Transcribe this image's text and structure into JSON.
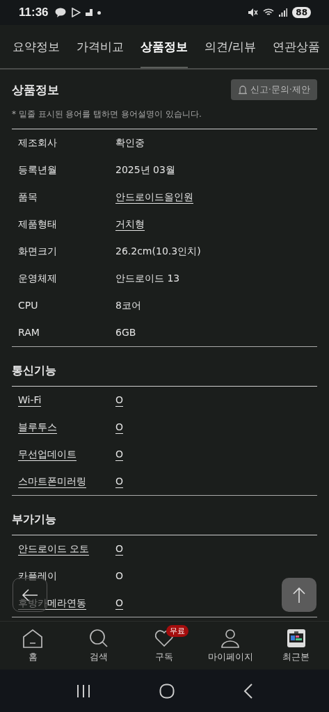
{
  "status_bar": {
    "time": "11:36",
    "battery": "88"
  },
  "tabs": [
    {
      "label": "요약정보",
      "selected": false
    },
    {
      "label": "가격비교",
      "selected": false
    },
    {
      "label": "상품정보",
      "selected": true
    },
    {
      "label": "의견/리뷰",
      "selected": false
    },
    {
      "label": "연관상품",
      "selected": false
    }
  ],
  "header": {
    "title": "상품정보",
    "report_button": "신고·문의·제안",
    "note": "* 밑줄 표시된 용어를 탭하면 용어설명이 있습니다."
  },
  "sections": [
    {
      "rows": [
        {
          "label": "제조회사",
          "value": "확인중",
          "label_linked": false,
          "value_linked": false
        },
        {
          "label": "등록년월",
          "value": "2025년 03월",
          "label_linked": false,
          "value_linked": false
        },
        {
          "label": "품목",
          "value": "안드로이드올인원",
          "label_linked": false,
          "value_linked": true
        },
        {
          "label": "제품형태",
          "value": "거치형",
          "label_linked": false,
          "value_linked": true
        },
        {
          "label": "화면크기",
          "value": "26.2cm(10.3인치)",
          "label_linked": false,
          "value_linked": false
        },
        {
          "label": "운영체제",
          "value": "안드로이드 13",
          "label_linked": false,
          "value_linked": false
        },
        {
          "label": "CPU",
          "value": "8코어",
          "label_linked": false,
          "value_linked": false
        },
        {
          "label": "RAM",
          "value": "6GB",
          "label_linked": false,
          "value_linked": false
        }
      ]
    },
    {
      "title": "통신기능",
      "rows": [
        {
          "label": "Wi-Fi",
          "value": "O",
          "label_linked": true,
          "value_linked": true
        },
        {
          "label": "블루투스",
          "value": "O",
          "label_linked": true,
          "value_linked": true
        },
        {
          "label": "무선업데이트",
          "value": "O",
          "label_linked": true,
          "value_linked": true
        },
        {
          "label": "스마트폰미러링",
          "value": "O",
          "label_linked": true,
          "value_linked": true
        }
      ]
    },
    {
      "title": "부가기능",
      "rows": [
        {
          "label": "안드로이드 오토",
          "value": "O",
          "label_linked": true,
          "value_linked": true
        },
        {
          "label": "카플레이",
          "value": "O",
          "label_linked": false,
          "value_linked": false
        },
        {
          "label": "후방카메라연동",
          "value": "O",
          "label_linked": true,
          "value_linked": true
        }
      ]
    }
  ],
  "bottom_nav": [
    {
      "kind": "home",
      "label": "홈"
    },
    {
      "kind": "search",
      "label": "검색"
    },
    {
      "kind": "subscribe",
      "label": "구독",
      "badge": "무료"
    },
    {
      "kind": "mypage",
      "label": "마이페이지"
    },
    {
      "kind": "recent",
      "label": "최근본"
    }
  ]
}
